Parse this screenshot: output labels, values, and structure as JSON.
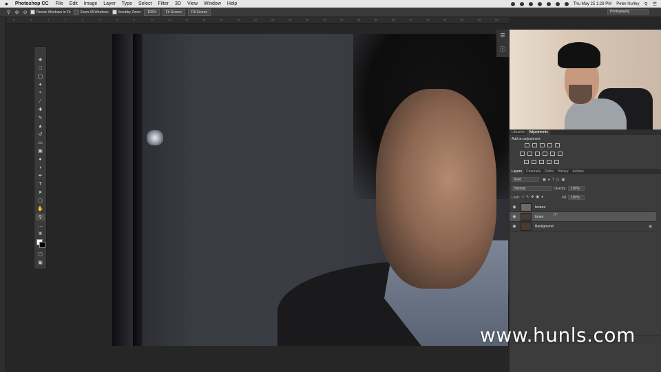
{
  "menubar": {
    "apple": "",
    "app_name": "Photoshop CC",
    "items": [
      "File",
      "Edit",
      "Image",
      "Layer",
      "Type",
      "Select",
      "Filter",
      "3D",
      "View",
      "Window",
      "Help"
    ],
    "clock": "Thu May 25  1:28 PM",
    "user": "Peter Hurley"
  },
  "options_bar": {
    "resize_windows_label": "Resize Windows to Fit",
    "zoom_all_label": "Zoom All Windows",
    "scrubby_label": "Scrubby Zoom",
    "zoom_value": "100%",
    "fit_screen_label": "Fit Screen",
    "fill_screen_label": "Fill Screen",
    "workspace": "Photography"
  },
  "ruler": {
    "ticks": [
      "6",
      "4",
      "2",
      "0",
      "2",
      "4",
      "6",
      "8",
      "10",
      "12",
      "14",
      "16",
      "18",
      "20",
      "22",
      "24",
      "26",
      "28",
      "30",
      "32",
      "34",
      "36",
      "38",
      "40",
      "42",
      "44",
      "46",
      "48",
      "50"
    ]
  },
  "panels": {
    "top_tabs": [
      "Libraries",
      "Adjustments"
    ],
    "add_adjustment": "Add an adjustment",
    "layer_tabs": [
      "Layers",
      "Channels",
      "Paths",
      "History",
      "Actions"
    ],
    "kind_label": "Kind",
    "blend_mode": "Normal",
    "opacity_label": "Opacity:",
    "opacity_value": "100%",
    "lock_label": "Lock:",
    "fill_label": "Fill:",
    "fill_value": "100%",
    "layers": [
      {
        "name": "texture"
      },
      {
        "name": "tones"
      },
      {
        "name": "Background"
      }
    ]
  },
  "watermark": "www.hunls.com",
  "icons": {
    "tools": [
      "move-icon",
      "marquee-icon",
      "lasso-icon",
      "magic-wand-icon",
      "crop-icon",
      "eyedropper-icon",
      "healing-brush-icon",
      "brush-icon",
      "clone-stamp-icon",
      "history-brush-icon",
      "eraser-icon",
      "gradient-icon",
      "blur-icon",
      "dodge-icon",
      "pen-icon",
      "type-icon",
      "path-selection-icon",
      "rectangle-icon",
      "hand-icon",
      "zoom-icon",
      "more-tools-icon"
    ]
  }
}
